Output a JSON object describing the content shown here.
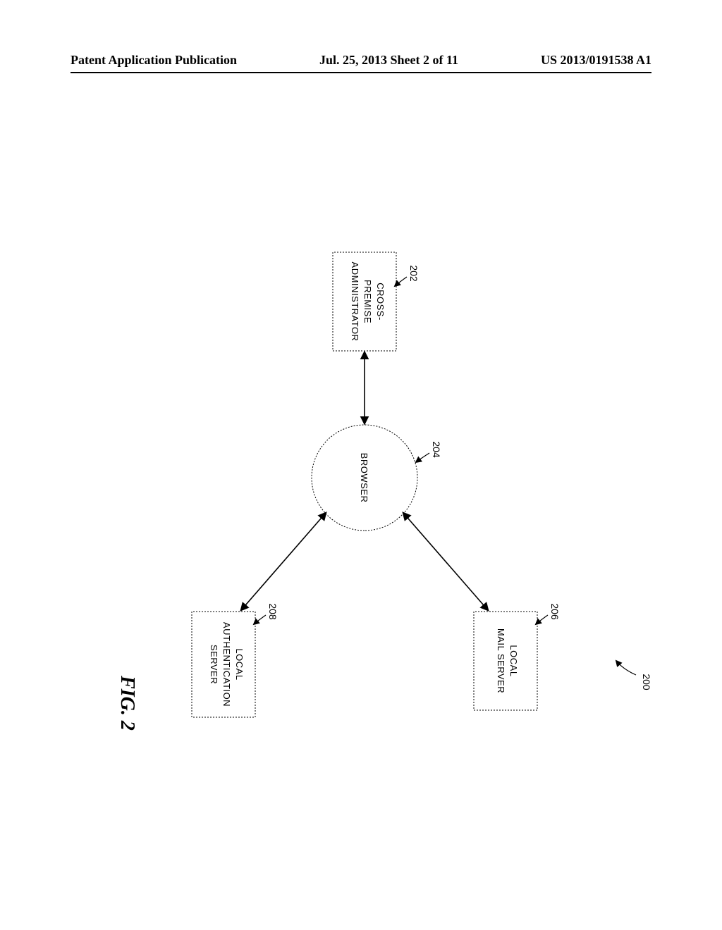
{
  "header": {
    "left": "Patent Application Publication",
    "center": "Jul. 25, 2013  Sheet 2 of 11",
    "right": "US 2013/0191538 A1"
  },
  "figure": {
    "label": "FIG. 2",
    "ref_overall": "200",
    "nodes": {
      "admin": {
        "ref": "202",
        "line1": "CROSS-",
        "line2": "PREMISE",
        "line3": "ADMINISTRATOR"
      },
      "browser": {
        "ref": "204",
        "label": "BROWSER"
      },
      "mail": {
        "ref": "206",
        "line1": "LOCAL",
        "line2": "MAIL SERVER"
      },
      "auth": {
        "ref": "208",
        "line1": "LOCAL",
        "line2": "AUTHENTICATION",
        "line3": "SERVER"
      }
    }
  }
}
